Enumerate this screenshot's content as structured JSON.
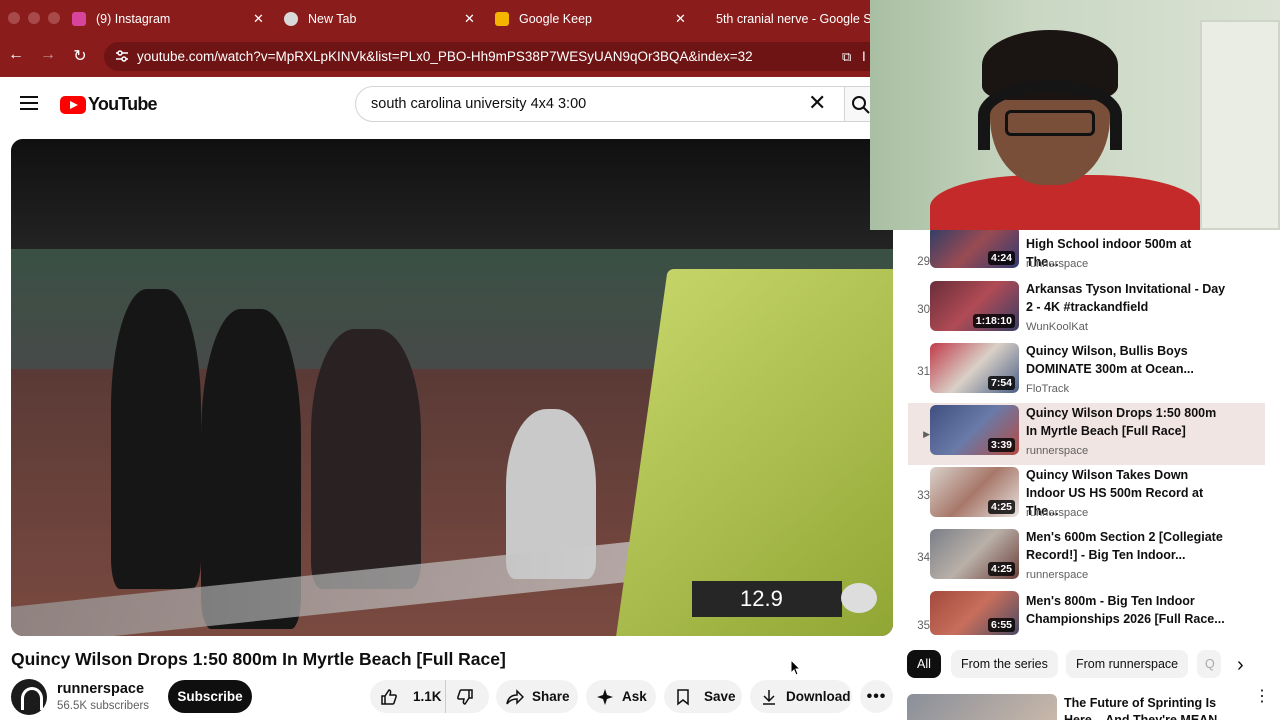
{
  "browser": {
    "tabs": [
      {
        "title": "(9) Instagram",
        "favicon": "instagram-icon"
      },
      {
        "title": "New Tab",
        "favicon": "chrome-icon"
      },
      {
        "title": "Google Keep",
        "favicon": "keep-icon"
      },
      {
        "title": "5th cranial nerve - Google S",
        "favicon": "google-icon"
      }
    ],
    "url": "youtube.com/watch?v=MpRXLpKINVk&list=PLx0_PBO-Hh9mPS38P7WESyUAN9qOr3BQA&index=32",
    "url_suffix": "I",
    "accent": "#8b1c1c"
  },
  "youtube": {
    "logo_text": "YouTube",
    "search_value": "south carolina university 4x4 3:00"
  },
  "video": {
    "timer_text": "12.9",
    "title": "Quincy Wilson Drops 1:50 800m In Myrtle Beach [Full Race]"
  },
  "channel": {
    "name": "runnerspace",
    "subscribers": "56.5K subscribers",
    "subscribe_label": "Subscribe"
  },
  "actions": {
    "like_count": "1.1K",
    "share": "Share",
    "ask": "Ask",
    "save": "Save",
    "download": "Download"
  },
  "playlist": [
    {
      "index": "29",
      "title": "High School indoor 500m at The...",
      "channel": "runnerspace",
      "duration": "4:24",
      "active": false
    },
    {
      "index": "30",
      "title": "Arkansas Tyson Invitational - Day 2 - 4K #trackandfield",
      "channel": "WunKoolKat",
      "duration": "1:18:10",
      "active": false
    },
    {
      "index": "31",
      "title": "Quincy Wilson, Bullis Boys DOMINATE 300m at Ocean...",
      "channel": "FloTrack",
      "duration": "7:54",
      "active": false
    },
    {
      "index": "",
      "title": "Quincy Wilson Drops 1:50 800m In Myrtle Beach [Full Race]",
      "channel": "runnerspace",
      "duration": "3:39",
      "active": true
    },
    {
      "index": "33",
      "title": "Quincy Wilson Takes Down Indoor US HS 500m Record at The...",
      "channel": "runnerspace",
      "duration": "4:25",
      "active": false
    },
    {
      "index": "34",
      "title": "Men's 600m Section 2 [Collegiate Record!] - Big Ten Indoor...",
      "channel": "runnerspace",
      "duration": "4:25",
      "active": false
    },
    {
      "index": "35",
      "title": "Men's 800m - Big Ten Indoor Championships 2026 [Full Race...",
      "channel": "",
      "duration": "6:55",
      "active": false
    }
  ],
  "chips": [
    "All",
    "From the series",
    "From runnerspace",
    "Q"
  ],
  "recommendation": {
    "title": "The Future of Sprinting Is Here... And They're MEAN"
  }
}
